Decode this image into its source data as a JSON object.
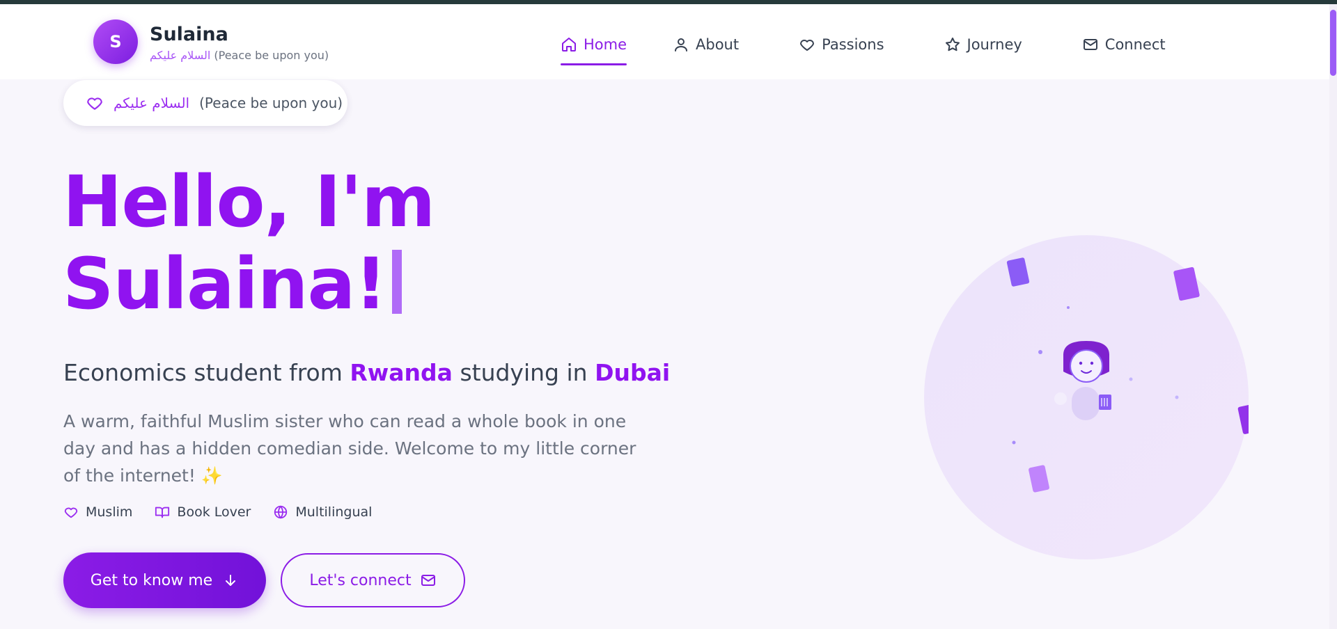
{
  "header": {
    "logo_letter": "S",
    "brand_name": "Sulaina",
    "brand_sub_arabic": "السلام عليكم",
    "brand_sub_english": "(Peace be upon you)",
    "nav": [
      {
        "label": "Home",
        "icon": "home-icon",
        "active": true
      },
      {
        "label": "About",
        "icon": "user-icon",
        "active": false
      },
      {
        "label": "Passions",
        "icon": "heart-icon",
        "active": false
      },
      {
        "label": "Journey",
        "icon": "star-icon",
        "active": false
      },
      {
        "label": "Connect",
        "icon": "mail-icon",
        "active": false
      }
    ]
  },
  "hero": {
    "greeting_arabic": "السلام عليكم",
    "greeting_english": "(Peace be upon you)",
    "title_line1": "Hello, I'm",
    "title_line2": "Sulaina!",
    "subtitle_prefix": "Economics student from",
    "subtitle_country": "Rwanda",
    "subtitle_middle": "studying in",
    "subtitle_city": "Dubai",
    "description": "A warm, faithful Muslim sister who can read a whole book in one day and has a hidden comedian side. Welcome to my little corner of the internet! ✨",
    "tags": [
      {
        "label": "Muslim",
        "icon": "heart-icon"
      },
      {
        "label": "Book Lover",
        "icon": "book-icon"
      },
      {
        "label": "Multilingual",
        "icon": "globe-icon"
      }
    ],
    "primary_button": "Get to know me",
    "secondary_button": "Let's connect"
  },
  "colors": {
    "accent": "#8b1ce6",
    "accent_light": "#a855f7",
    "background": "#f8f6fc"
  }
}
